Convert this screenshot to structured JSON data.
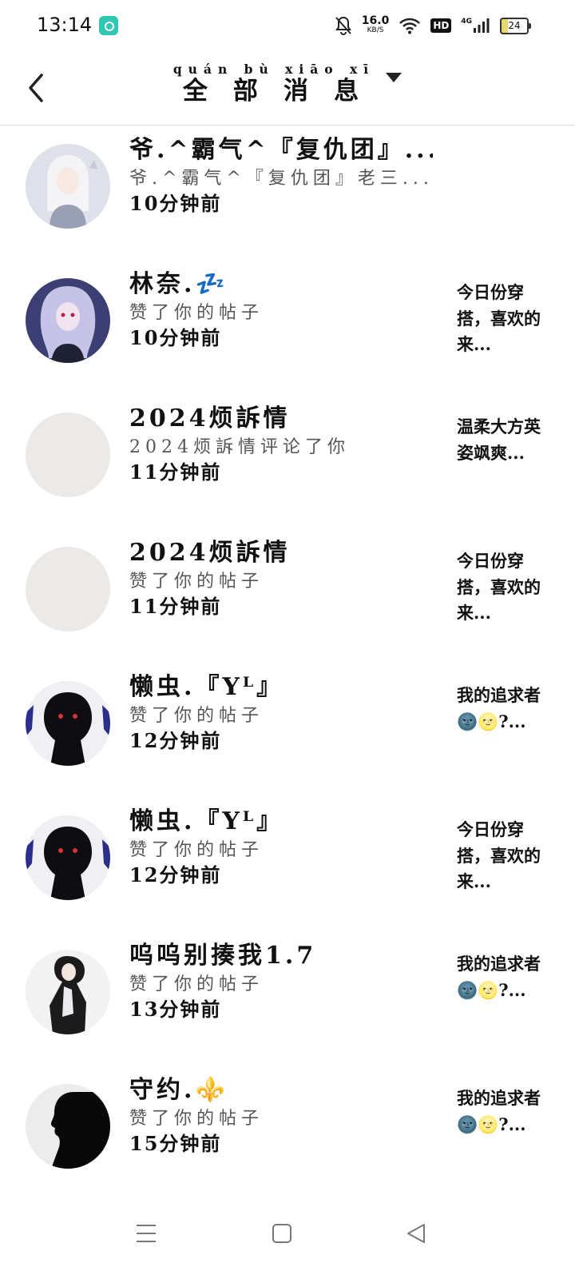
{
  "status_bar": {
    "time": "13:14",
    "net_speed": "16.0",
    "net_unit": "KB/S",
    "hd": "HD",
    "network": "4G",
    "battery": "24"
  },
  "header": {
    "title": "全部消息",
    "title_pinyin": "quán bù xiāo xī"
  },
  "messages": [
    {
      "name": "爷.^霸气^『复仇团』...",
      "action": "爷.^霸气^『复仇团』老三...",
      "time": "10分钟前",
      "badge": "heart",
      "preview": "",
      "avatar": "anime-girl-white-hair"
    },
    {
      "name": "林奈.💤",
      "action": "赞了你的帖子",
      "time": "10分钟前",
      "badge": "like",
      "preview": "今日份穿搭，喜欢的来...",
      "avatar": "anime-girl-purple"
    },
    {
      "name": "2024烦訴情",
      "action": "2024烦訴情评论了你",
      "time": "11分钟前",
      "badge": "comment",
      "preview": "温柔大方英姿飒爽...",
      "avatar": "blank"
    },
    {
      "name": "2024烦訴情",
      "action": "赞了你的帖子",
      "time": "11分钟前",
      "badge": "like",
      "preview": "今日份穿搭，喜欢的来...",
      "avatar": "blank"
    },
    {
      "name": "懒虫.『Yᴸ』",
      "action": "赞了你的帖子",
      "time": "12分钟前",
      "badge": "like",
      "preview": "我的追求者🌚🌝?...",
      "avatar": "dark-silhouette"
    },
    {
      "name": "懒虫.『Yᴸ』",
      "action": "赞了你的帖子",
      "time": "12分钟前",
      "badge": "like",
      "preview": "今日份穿搭，喜欢的来...",
      "avatar": "dark-silhouette"
    },
    {
      "name": "呜呜别揍我1.7",
      "action": "赞了你的帖子",
      "time": "13分钟前",
      "badge": "like",
      "preview": "我的追求者🌚🌝?...",
      "avatar": "anime-boy"
    },
    {
      "name": "守约.⚜️",
      "action": "赞了你的帖子",
      "time": "15分钟前",
      "badge": "like",
      "preview": "我的追求者🌚🌝?...",
      "avatar": "black-profile"
    }
  ],
  "colors": {
    "badge_like": "#f07a22",
    "badge_heart": "#f6b12a",
    "badge_comment": "#6cb1ef",
    "divider": "#e3e3e3"
  }
}
